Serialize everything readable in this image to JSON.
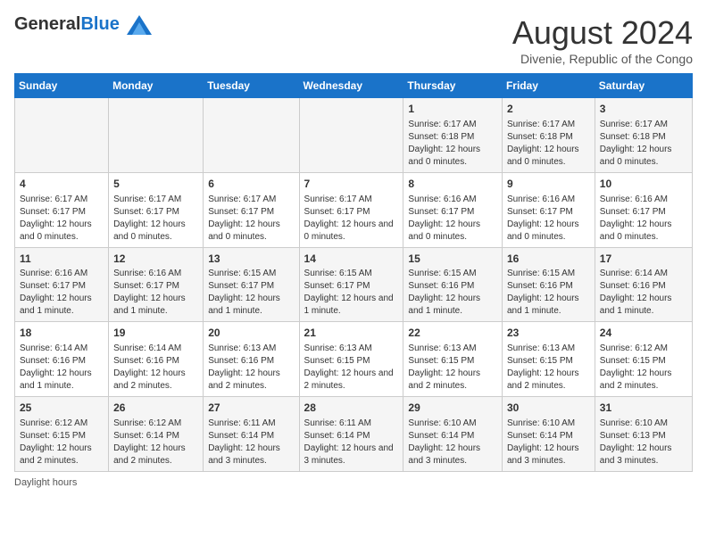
{
  "header": {
    "logo_general": "General",
    "logo_blue": "Blue",
    "title": "August 2024",
    "subtitle": "Divenie, Republic of the Congo"
  },
  "days_of_week": [
    "Sunday",
    "Monday",
    "Tuesday",
    "Wednesday",
    "Thursday",
    "Friday",
    "Saturday"
  ],
  "weeks": [
    [
      {
        "num": "",
        "info": ""
      },
      {
        "num": "",
        "info": ""
      },
      {
        "num": "",
        "info": ""
      },
      {
        "num": "",
        "info": ""
      },
      {
        "num": "1",
        "info": "Sunrise: 6:17 AM\nSunset: 6:18 PM\nDaylight: 12 hours and 0 minutes."
      },
      {
        "num": "2",
        "info": "Sunrise: 6:17 AM\nSunset: 6:18 PM\nDaylight: 12 hours and 0 minutes."
      },
      {
        "num": "3",
        "info": "Sunrise: 6:17 AM\nSunset: 6:18 PM\nDaylight: 12 hours and 0 minutes."
      }
    ],
    [
      {
        "num": "4",
        "info": "Sunrise: 6:17 AM\nSunset: 6:17 PM\nDaylight: 12 hours and 0 minutes."
      },
      {
        "num": "5",
        "info": "Sunrise: 6:17 AM\nSunset: 6:17 PM\nDaylight: 12 hours and 0 minutes."
      },
      {
        "num": "6",
        "info": "Sunrise: 6:17 AM\nSunset: 6:17 PM\nDaylight: 12 hours and 0 minutes."
      },
      {
        "num": "7",
        "info": "Sunrise: 6:17 AM\nSunset: 6:17 PM\nDaylight: 12 hours and 0 minutes."
      },
      {
        "num": "8",
        "info": "Sunrise: 6:16 AM\nSunset: 6:17 PM\nDaylight: 12 hours and 0 minutes."
      },
      {
        "num": "9",
        "info": "Sunrise: 6:16 AM\nSunset: 6:17 PM\nDaylight: 12 hours and 0 minutes."
      },
      {
        "num": "10",
        "info": "Sunrise: 6:16 AM\nSunset: 6:17 PM\nDaylight: 12 hours and 0 minutes."
      }
    ],
    [
      {
        "num": "11",
        "info": "Sunrise: 6:16 AM\nSunset: 6:17 PM\nDaylight: 12 hours and 1 minute."
      },
      {
        "num": "12",
        "info": "Sunrise: 6:16 AM\nSunset: 6:17 PM\nDaylight: 12 hours and 1 minute."
      },
      {
        "num": "13",
        "info": "Sunrise: 6:15 AM\nSunset: 6:17 PM\nDaylight: 12 hours and 1 minute."
      },
      {
        "num": "14",
        "info": "Sunrise: 6:15 AM\nSunset: 6:17 PM\nDaylight: 12 hours and 1 minute."
      },
      {
        "num": "15",
        "info": "Sunrise: 6:15 AM\nSunset: 6:16 PM\nDaylight: 12 hours and 1 minute."
      },
      {
        "num": "16",
        "info": "Sunrise: 6:15 AM\nSunset: 6:16 PM\nDaylight: 12 hours and 1 minute."
      },
      {
        "num": "17",
        "info": "Sunrise: 6:14 AM\nSunset: 6:16 PM\nDaylight: 12 hours and 1 minute."
      }
    ],
    [
      {
        "num": "18",
        "info": "Sunrise: 6:14 AM\nSunset: 6:16 PM\nDaylight: 12 hours and 1 minute."
      },
      {
        "num": "19",
        "info": "Sunrise: 6:14 AM\nSunset: 6:16 PM\nDaylight: 12 hours and 2 minutes."
      },
      {
        "num": "20",
        "info": "Sunrise: 6:13 AM\nSunset: 6:16 PM\nDaylight: 12 hours and 2 minutes."
      },
      {
        "num": "21",
        "info": "Sunrise: 6:13 AM\nSunset: 6:15 PM\nDaylight: 12 hours and 2 minutes."
      },
      {
        "num": "22",
        "info": "Sunrise: 6:13 AM\nSunset: 6:15 PM\nDaylight: 12 hours and 2 minutes."
      },
      {
        "num": "23",
        "info": "Sunrise: 6:13 AM\nSunset: 6:15 PM\nDaylight: 12 hours and 2 minutes."
      },
      {
        "num": "24",
        "info": "Sunrise: 6:12 AM\nSunset: 6:15 PM\nDaylight: 12 hours and 2 minutes."
      }
    ],
    [
      {
        "num": "25",
        "info": "Sunrise: 6:12 AM\nSunset: 6:15 PM\nDaylight: 12 hours and 2 minutes."
      },
      {
        "num": "26",
        "info": "Sunrise: 6:12 AM\nSunset: 6:14 PM\nDaylight: 12 hours and 2 minutes."
      },
      {
        "num": "27",
        "info": "Sunrise: 6:11 AM\nSunset: 6:14 PM\nDaylight: 12 hours and 3 minutes."
      },
      {
        "num": "28",
        "info": "Sunrise: 6:11 AM\nSunset: 6:14 PM\nDaylight: 12 hours and 3 minutes."
      },
      {
        "num": "29",
        "info": "Sunrise: 6:10 AM\nSunset: 6:14 PM\nDaylight: 12 hours and 3 minutes."
      },
      {
        "num": "30",
        "info": "Sunrise: 6:10 AM\nSunset: 6:14 PM\nDaylight: 12 hours and 3 minutes."
      },
      {
        "num": "31",
        "info": "Sunrise: 6:10 AM\nSunset: 6:13 PM\nDaylight: 12 hours and 3 minutes."
      }
    ]
  ],
  "footer": {
    "daylight_label": "Daylight hours"
  },
  "colors": {
    "header_bg": "#1a73c9",
    "odd_row": "#f5f5f5",
    "even_row": "#ffffff"
  }
}
